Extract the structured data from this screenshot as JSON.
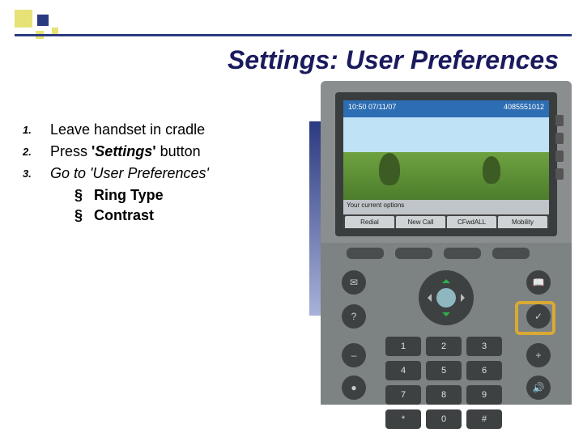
{
  "title": "Settings:  User Preferences",
  "steps": [
    {
      "num": "1.",
      "text": "Leave handset in cradle"
    },
    {
      "num": "2.",
      "text_pre": "Press ",
      "text_b": "'Settings'",
      "text_post": " button"
    },
    {
      "num": "3.",
      "text": "Go to 'User Preferences'",
      "italic": true
    }
  ],
  "subs": [
    "Ring Type",
    "Contrast"
  ],
  "sub_bullet": "§",
  "phone": {
    "screen_time": "10:50 07/11/07",
    "screen_ext": "4085551012",
    "options_label": "Your current options",
    "softkeys": [
      "Redial",
      "New Call",
      "CFwdALL",
      "Mobility"
    ],
    "keypad": [
      "1",
      "2",
      "3",
      "4",
      "5",
      "6",
      "7",
      "8",
      "9",
      "*",
      "0",
      "#"
    ],
    "icons": {
      "msg": "✉",
      "dir": "📖",
      "help": "?",
      "settings": "✓",
      "vol_dn": "–",
      "vol_up": "+",
      "mute": "●",
      "spk": "🔊"
    }
  }
}
